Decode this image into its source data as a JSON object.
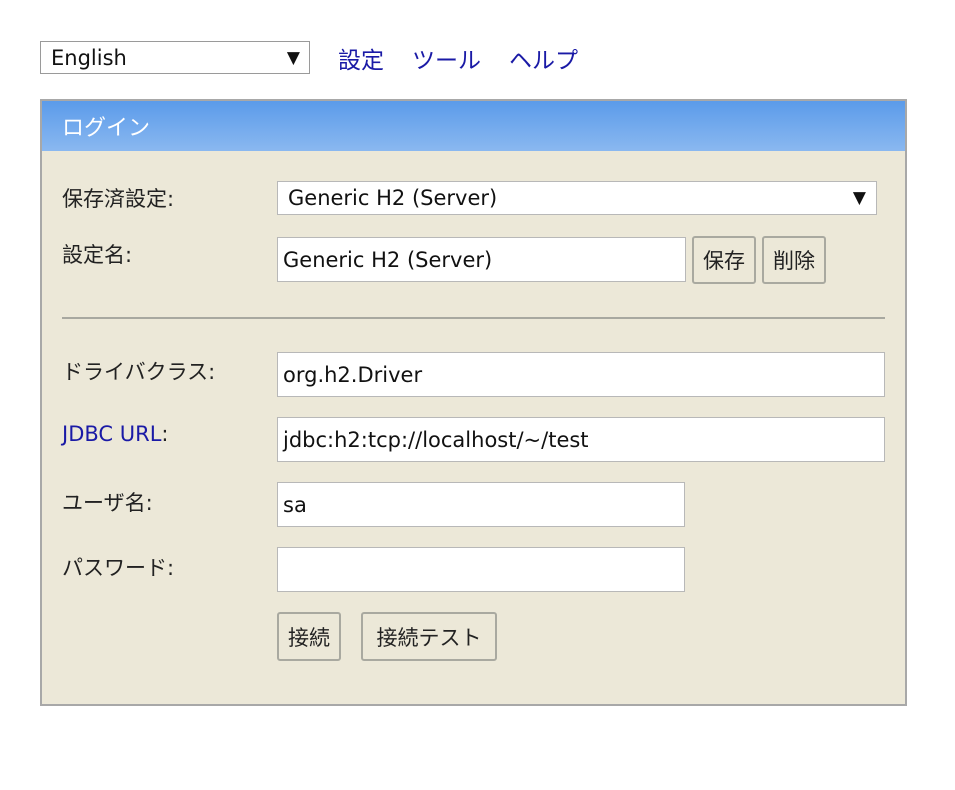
{
  "topbar": {
    "language": "English",
    "links": [
      "設定",
      "ツール",
      "ヘルプ"
    ]
  },
  "panel": {
    "title": "ログイン",
    "saved_settings_label": "保存済設定:",
    "saved_settings_value": "Generic H2 (Server)",
    "setting_name_label": "設定名:",
    "setting_name_value": "Generic H2 (Server)",
    "save_label": "保存",
    "delete_label": "削除",
    "driver_class_label": "ドライバクラス:",
    "driver_class_value": "org.h2.Driver",
    "jdbc_url_label": "JDBC URL",
    "jdbc_url_colon": ":",
    "jdbc_url_value": "jdbc:h2:tcp://localhost/~/test",
    "username_label": "ユーザ名:",
    "username_value": "sa",
    "password_label": "パスワード:",
    "password_value": "",
    "connect_label": "接続",
    "test_connection_label": "接続テスト"
  },
  "colors": {
    "header_gradient_top": "#5b9bea",
    "panel_background": "#ece8d8",
    "link": "#1a1aa6"
  }
}
